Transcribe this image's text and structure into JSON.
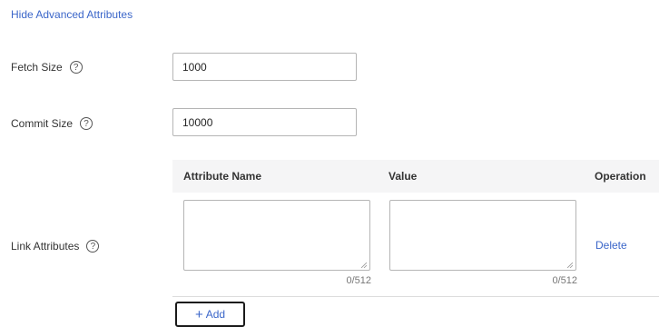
{
  "advanced_toggle": {
    "label": "Hide Advanced Attributes"
  },
  "fetch_size": {
    "label": "Fetch Size",
    "value": "1000"
  },
  "commit_size": {
    "label": "Commit Size",
    "value": "10000"
  },
  "link_attributes": {
    "label": "Link Attributes",
    "columns": [
      "Attribute Name",
      "Value",
      "Operation"
    ],
    "rows": [
      {
        "attribute_name": "",
        "attribute_counter": "0/512",
        "value": "",
        "value_counter": "0/512",
        "operation": "Delete"
      }
    ],
    "add_label": "Add"
  },
  "help_glyph": "?",
  "icons": {
    "help": "question-circle-icon",
    "add": "plus-icon",
    "resize": "resize-grip-icon"
  },
  "colors": {
    "link": "#3b66c9",
    "header_bg": "#f5f5f6",
    "border": "#b5b5b5"
  }
}
